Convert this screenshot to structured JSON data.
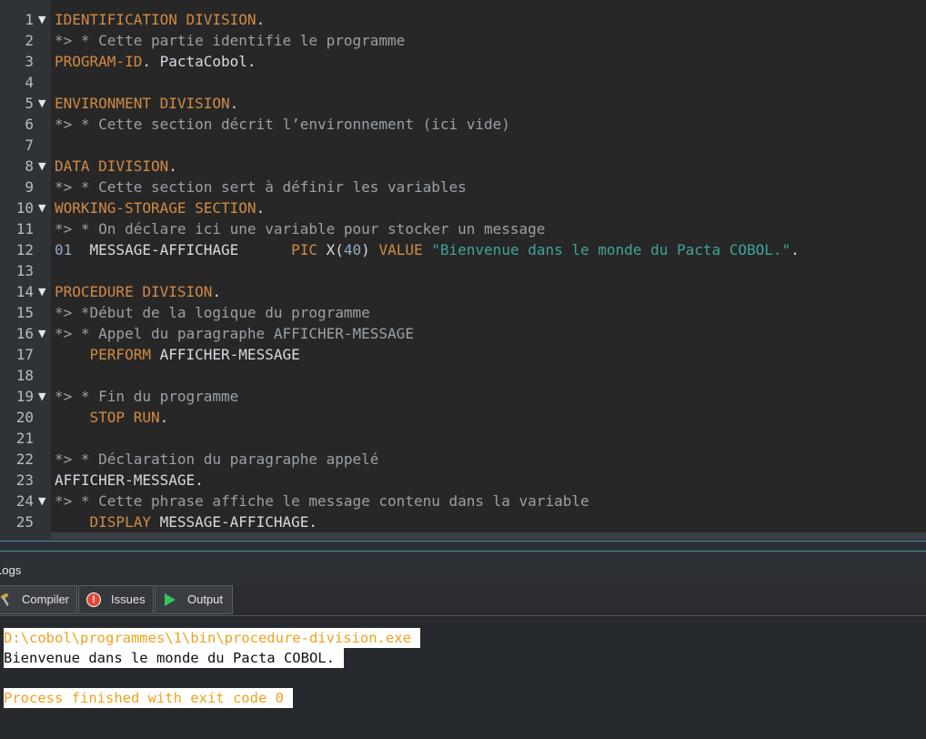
{
  "editor": {
    "lines": [
      {
        "n": "1",
        "fold": true,
        "segs": [
          {
            "t": "IDENTIFICATION DIVISION",
            "c": "kw"
          },
          {
            "t": ".",
            "c": "tx"
          }
        ]
      },
      {
        "n": "2",
        "fold": false,
        "segs": [
          {
            "t": "*> * Cette partie identifie le programme",
            "c": "cm"
          }
        ]
      },
      {
        "n": "3",
        "fold": false,
        "segs": [
          {
            "t": "PROGRAM-ID",
            "c": "kw"
          },
          {
            "t": ". PactaCobol.",
            "c": "tx"
          }
        ]
      },
      {
        "n": "4",
        "fold": false,
        "segs": []
      },
      {
        "n": "5",
        "fold": true,
        "segs": [
          {
            "t": "ENVIRONMENT DIVISION",
            "c": "kw"
          },
          {
            "t": ".",
            "c": "tx"
          }
        ]
      },
      {
        "n": "6",
        "fold": false,
        "segs": [
          {
            "t": "*> * Cette section décrit l’environnement (ici vide)",
            "c": "cm"
          }
        ]
      },
      {
        "n": "7",
        "fold": false,
        "segs": []
      },
      {
        "n": "8",
        "fold": true,
        "segs": [
          {
            "t": "DATA DIVISION",
            "c": "kw"
          },
          {
            "t": ".",
            "c": "tx"
          }
        ]
      },
      {
        "n": "9",
        "fold": false,
        "segs": [
          {
            "t": "*> * Cette section sert à définir les variables",
            "c": "cm"
          }
        ]
      },
      {
        "n": "10",
        "fold": true,
        "segs": [
          {
            "t": "WORKING-STORAGE SECTION",
            "c": "kw"
          },
          {
            "t": ".",
            "c": "tx"
          }
        ]
      },
      {
        "n": "11",
        "fold": false,
        "segs": [
          {
            "t": "*> * On déclare ici une variable pour stocker un message",
            "c": "cm"
          }
        ]
      },
      {
        "n": "12",
        "fold": false,
        "segs": [
          {
            "t": "01",
            "c": "nm"
          },
          {
            "t": "  MESSAGE-AFFICHAGE      ",
            "c": "tx"
          },
          {
            "t": "PIC",
            "c": "kw"
          },
          {
            "t": " X(",
            "c": "tx"
          },
          {
            "t": "40",
            "c": "nm"
          },
          {
            "t": ") ",
            "c": "tx"
          },
          {
            "t": "VALUE",
            "c": "kw"
          },
          {
            "t": " ",
            "c": "tx"
          },
          {
            "t": "\"Bienvenue dans le monde du Pacta COBOL.\"",
            "c": "st"
          },
          {
            "t": ".",
            "c": "tx"
          }
        ]
      },
      {
        "n": "13",
        "fold": false,
        "segs": []
      },
      {
        "n": "14",
        "fold": true,
        "segs": [
          {
            "t": "PROCEDURE DIVISION",
            "c": "kw"
          },
          {
            "t": ".",
            "c": "tx"
          }
        ]
      },
      {
        "n": "15",
        "fold": false,
        "segs": [
          {
            "t": "*> *Début de la logique du programme",
            "c": "cm"
          }
        ]
      },
      {
        "n": "16",
        "fold": true,
        "segs": [
          {
            "t": "*> * Appel du paragraphe AFFICHER-MESSAGE",
            "c": "cm"
          }
        ]
      },
      {
        "n": "17",
        "fold": false,
        "segs": [
          {
            "t": "    ",
            "c": "tx"
          },
          {
            "t": "PERFORM",
            "c": "kw"
          },
          {
            "t": " AFFICHER-MESSAGE",
            "c": "tx"
          }
        ]
      },
      {
        "n": "18",
        "fold": false,
        "segs": []
      },
      {
        "n": "19",
        "fold": true,
        "segs": [
          {
            "t": "*> * Fin du programme",
            "c": "cm"
          }
        ]
      },
      {
        "n": "20",
        "fold": false,
        "segs": [
          {
            "t": "    ",
            "c": "tx"
          },
          {
            "t": "STOP RUN",
            "c": "kw"
          },
          {
            "t": ".",
            "c": "tx"
          }
        ]
      },
      {
        "n": "21",
        "fold": false,
        "segs": []
      },
      {
        "n": "22",
        "fold": false,
        "segs": [
          {
            "t": "*> * Déclaration du paragraphe appelé",
            "c": "cm"
          }
        ]
      },
      {
        "n": "23",
        "fold": false,
        "segs": [
          {
            "t": "AFFICHER-MESSAGE.",
            "c": "tx"
          }
        ]
      },
      {
        "n": "24",
        "fold": true,
        "segs": [
          {
            "t": "*> * Cette phrase affiche le message contenu dans la variable",
            "c": "cm"
          }
        ]
      },
      {
        "n": "25",
        "fold": false,
        "segs": [
          {
            "t": "    ",
            "c": "tx"
          },
          {
            "t": "DISPLAY",
            "c": "kw"
          },
          {
            "t": " MESSAGE-AFFICHAGE.",
            "c": "tx"
          }
        ]
      }
    ]
  },
  "logs": {
    "title": "Logs",
    "tabs": {
      "compiler": "Compiler",
      "issues": "Issues",
      "output": "Output"
    },
    "issue_icon_glyph": "!",
    "output_lines": [
      {
        "text": "D:\\cobol\\programmes\\1\\bin\\procedure-division.exe",
        "style": "orange"
      },
      {
        "text": "Bienvenue dans le monde du Pacta COBOL.",
        "style": "white"
      },
      {
        "text": "",
        "style": "blank"
      },
      {
        "text": "Process finished with exit code 0",
        "style": "orange"
      }
    ]
  },
  "colors": {
    "keyword": "#d18a45",
    "comment": "#9aa0a6",
    "string": "#3ea49a",
    "number": "#8fa9c4",
    "output_orange": "#f0a11c",
    "splitter_accent": "#4b8fb8"
  }
}
